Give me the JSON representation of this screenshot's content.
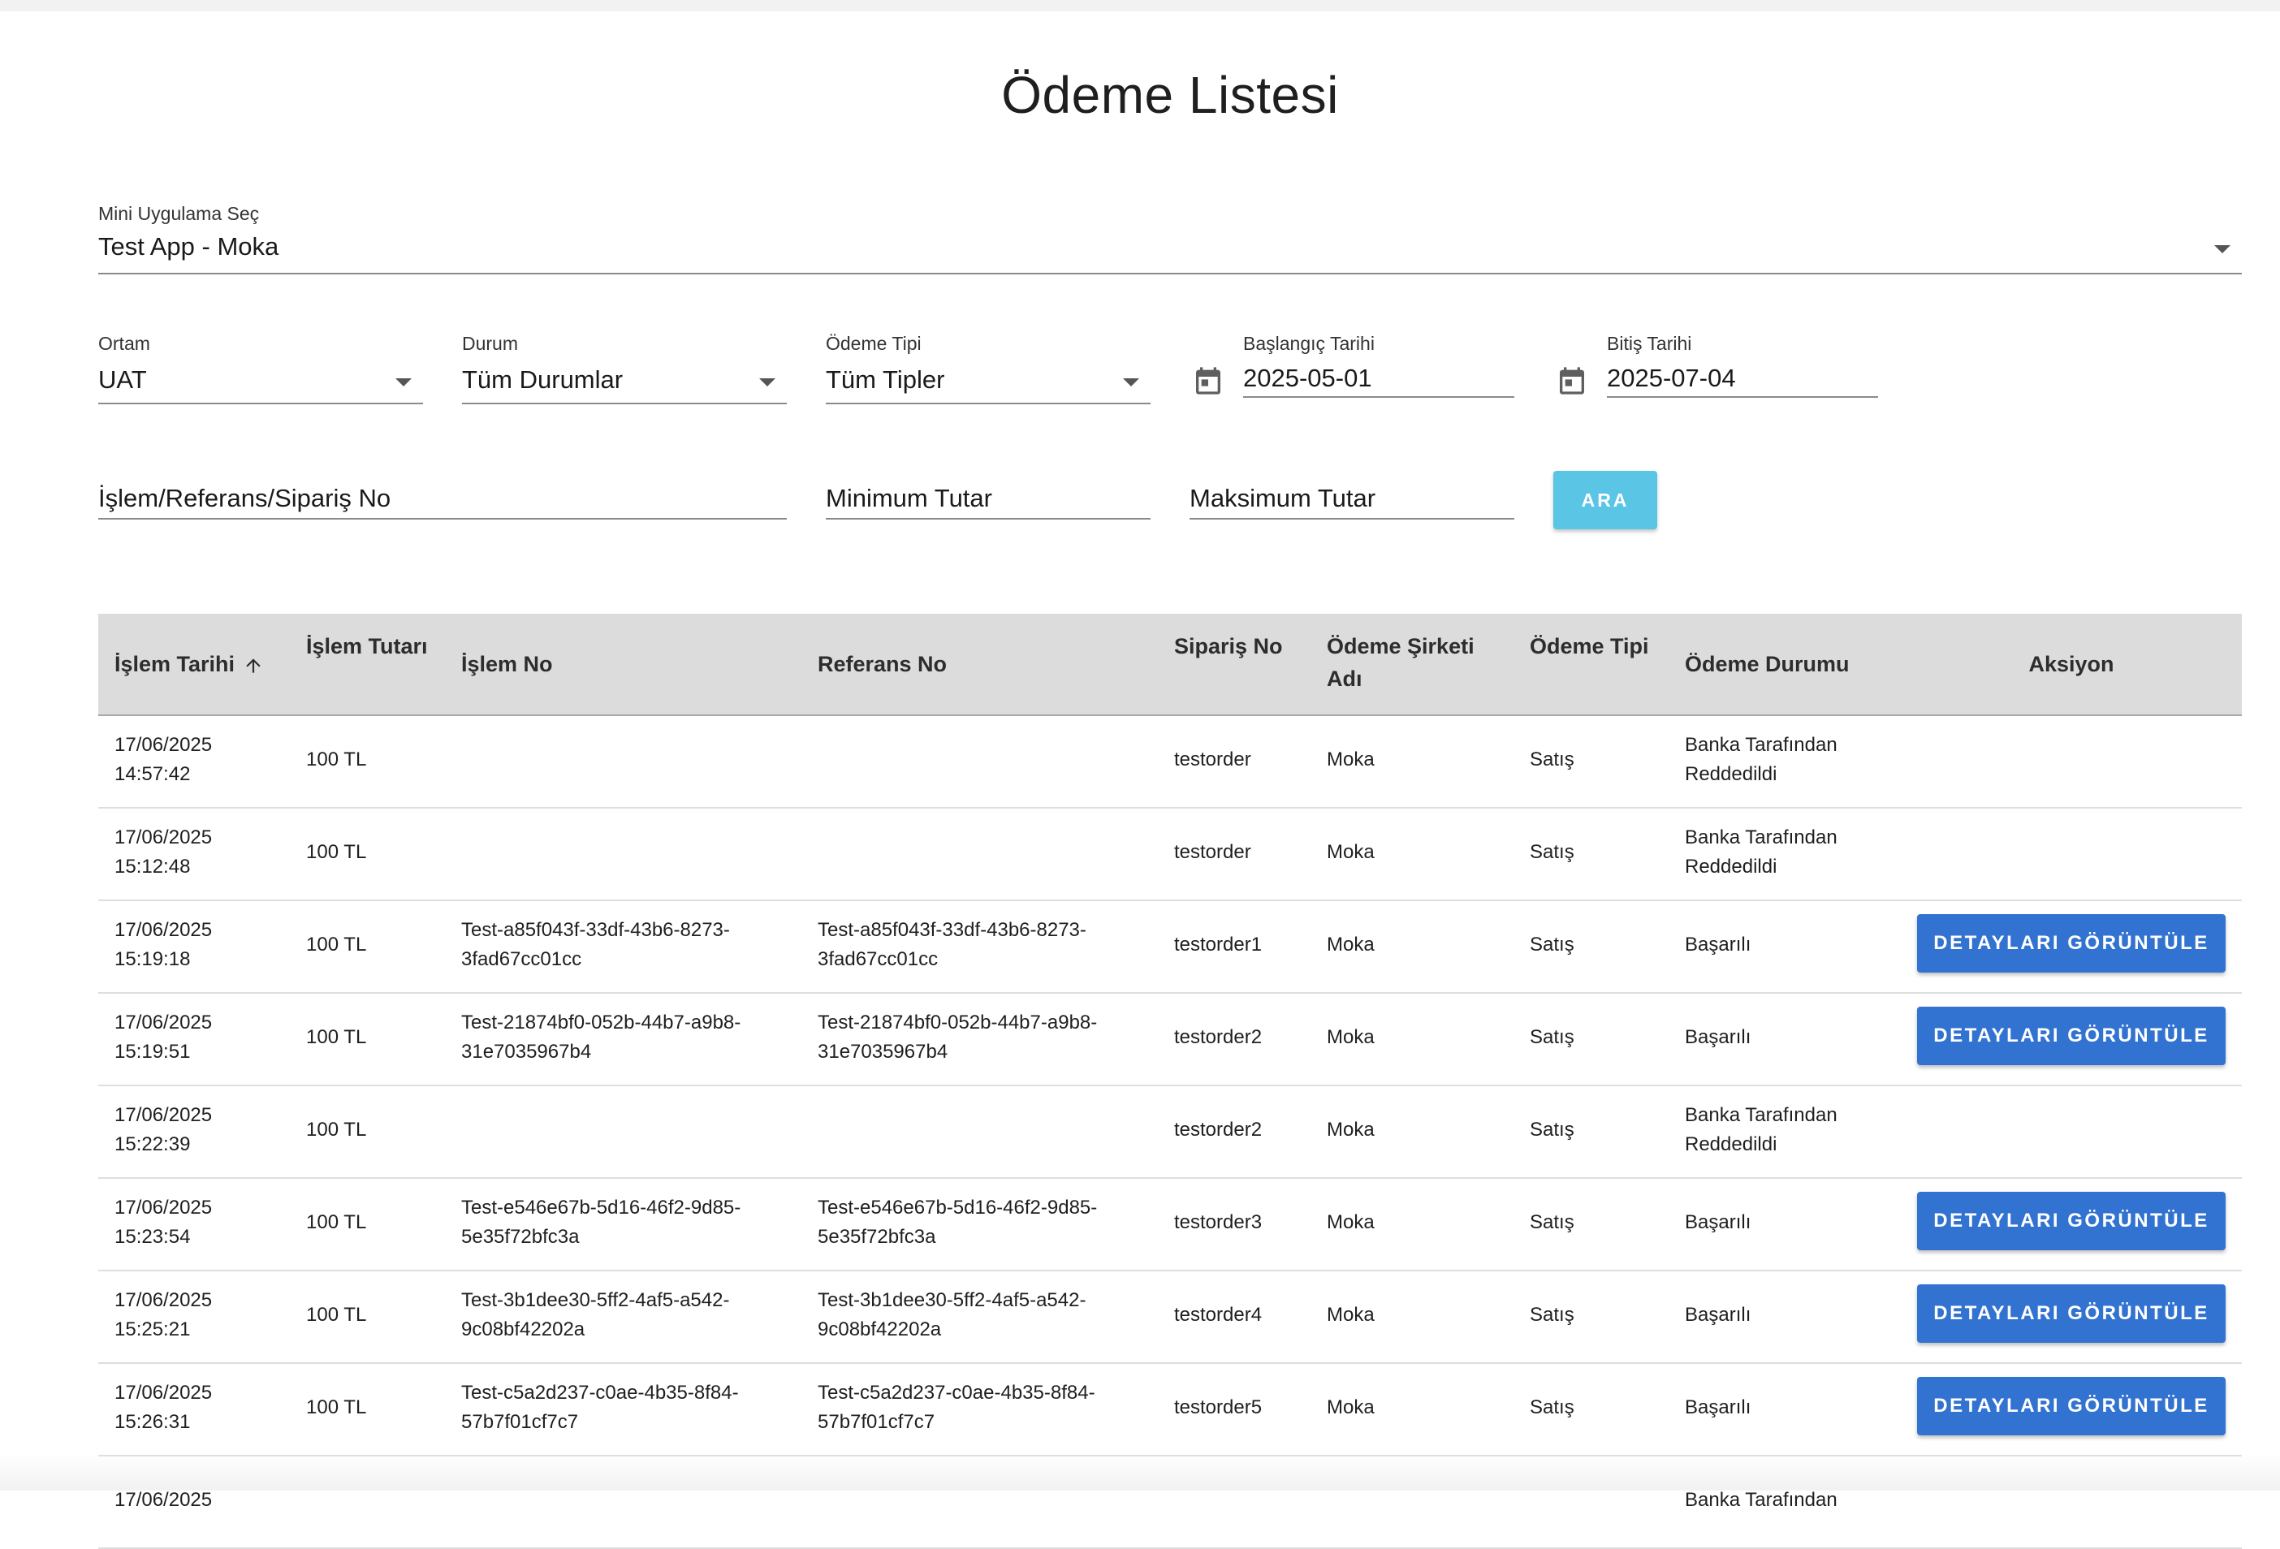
{
  "page": {
    "title": "Ödeme Listesi"
  },
  "app_select": {
    "label": "Mini Uygulama Seç",
    "value": "Test App - Moka"
  },
  "filters": {
    "ortam": {
      "label": "Ortam",
      "value": "UAT"
    },
    "durum": {
      "label": "Durum",
      "value": "Tüm Durumlar"
    },
    "odeme_tipi": {
      "label": "Ödeme Tipi",
      "value": "Tüm Tipler"
    },
    "baslangic": {
      "label": "Başlangıç Tarihi",
      "value": "2025-05-01"
    },
    "bitis": {
      "label": "Bitiş Tarihi",
      "value": "2025-07-04"
    },
    "islem_no": {
      "placeholder": "İşlem/Referans/Sipariş No"
    },
    "min_tutar": {
      "placeholder": "Minimum Tutar"
    },
    "max_tutar": {
      "placeholder": "Maksimum Tutar"
    },
    "search_label": "ARA"
  },
  "table": {
    "headers": {
      "islem_tarihi": "İşlem Tarihi",
      "islem_tutari": "İşlem Tutarı",
      "islem_no": "İşlem No",
      "referans_no": "Referans No",
      "siparis_no": "Sipariş No",
      "odeme_sirketi_line1": "Ödeme Şirketi",
      "odeme_sirketi_line2": "Adı",
      "odeme_tipi": "Ödeme Tipi",
      "odeme_durumu": "Ödeme Durumu",
      "aksiyon": "Aksiyon"
    },
    "sort_icon": "arrow-up-icon",
    "detail_button_label": "DETAYLARI GÖRÜNTÜLE",
    "rows": [
      {
        "date": "17/06/2025",
        "time": "14:57:42",
        "amount": "100 TL",
        "islem_no_1": "",
        "islem_no_2": "",
        "ref_no_1": "",
        "ref_no_2": "",
        "order": "testorder",
        "company": "Moka",
        "type": "Satış",
        "status_1": "Banka Tarafından",
        "status_2": "Reddedildi",
        "has_detail": false
      },
      {
        "date": "17/06/2025",
        "time": "15:12:48",
        "amount": "100 TL",
        "islem_no_1": "",
        "islem_no_2": "",
        "ref_no_1": "",
        "ref_no_2": "",
        "order": "testorder",
        "company": "Moka",
        "type": "Satış",
        "status_1": "Banka Tarafından",
        "status_2": "Reddedildi",
        "has_detail": false
      },
      {
        "date": "17/06/2025",
        "time": "15:19:18",
        "amount": "100 TL",
        "islem_no_1": "Test-a85f043f-33df-43b6-8273-",
        "islem_no_2": "3fad67cc01cc",
        "ref_no_1": "Test-a85f043f-33df-43b6-8273-",
        "ref_no_2": "3fad67cc01cc",
        "order": "testorder1",
        "company": "Moka",
        "type": "Satış",
        "status_1": "Başarılı",
        "status_2": "",
        "has_detail": true
      },
      {
        "date": "17/06/2025",
        "time": "15:19:51",
        "amount": "100 TL",
        "islem_no_1": "Test-21874bf0-052b-44b7-a9b8-",
        "islem_no_2": "31e7035967b4",
        "ref_no_1": "Test-21874bf0-052b-44b7-a9b8-",
        "ref_no_2": "31e7035967b4",
        "order": "testorder2",
        "company": "Moka",
        "type": "Satış",
        "status_1": "Başarılı",
        "status_2": "",
        "has_detail": true
      },
      {
        "date": "17/06/2025",
        "time": "15:22:39",
        "amount": "100 TL",
        "islem_no_1": "",
        "islem_no_2": "",
        "ref_no_1": "",
        "ref_no_2": "",
        "order": "testorder2",
        "company": "Moka",
        "type": "Satış",
        "status_1": "Banka Tarafından",
        "status_2": "Reddedildi",
        "has_detail": false
      },
      {
        "date": "17/06/2025",
        "time": "15:23:54",
        "amount": "100 TL",
        "islem_no_1": "Test-e546e67b-5d16-46f2-9d85-",
        "islem_no_2": "5e35f72bfc3a",
        "ref_no_1": "Test-e546e67b-5d16-46f2-9d85-",
        "ref_no_2": "5e35f72bfc3a",
        "order": "testorder3",
        "company": "Moka",
        "type": "Satış",
        "status_1": "Başarılı",
        "status_2": "",
        "has_detail": true
      },
      {
        "date": "17/06/2025",
        "time": "15:25:21",
        "amount": "100 TL",
        "islem_no_1": "Test-3b1dee30-5ff2-4af5-a542-",
        "islem_no_2": "9c08bf42202a",
        "ref_no_1": "Test-3b1dee30-5ff2-4af5-a542-",
        "ref_no_2": "9c08bf42202a",
        "order": "testorder4",
        "company": "Moka",
        "type": "Satış",
        "status_1": "Başarılı",
        "status_2": "",
        "has_detail": true
      },
      {
        "date": "17/06/2025",
        "time": "15:26:31",
        "amount": "100 TL",
        "islem_no_1": "Test-c5a2d237-c0ae-4b35-8f84-",
        "islem_no_2": "57b7f01cf7c7",
        "ref_no_1": "Test-c5a2d237-c0ae-4b35-8f84-",
        "ref_no_2": "57b7f01cf7c7",
        "order": "testorder5",
        "company": "Moka",
        "type": "Satış",
        "status_1": "Başarılı",
        "status_2": "",
        "has_detail": true
      },
      {
        "date": "17/06/2025",
        "time": "",
        "amount": "",
        "islem_no_1": "",
        "islem_no_2": "",
        "ref_no_1": "",
        "ref_no_2": "",
        "order": "",
        "company": "",
        "type": "",
        "status_1": "Banka Tarafından",
        "status_2": "",
        "has_detail": false
      }
    ]
  }
}
